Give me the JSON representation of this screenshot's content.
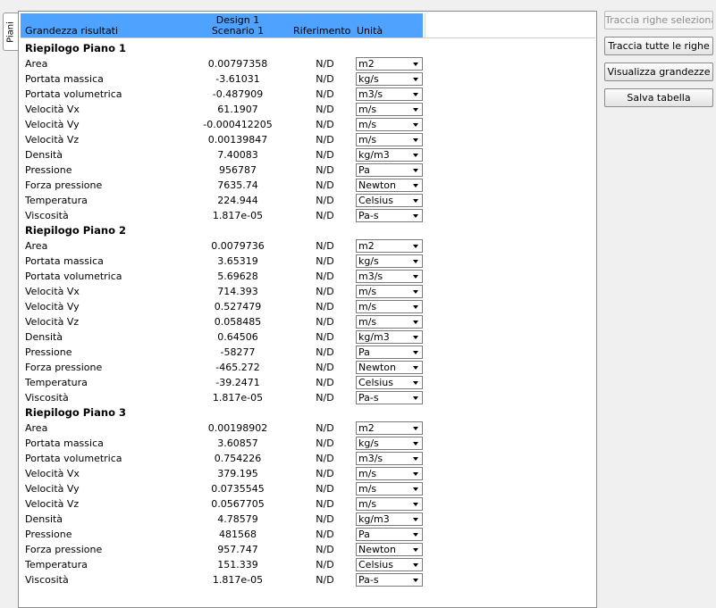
{
  "side_tab": "Piani",
  "header": {
    "col_name": "Grandezza risultati",
    "design": "Design 1",
    "scenario": "Scenario 1",
    "reference": "Riferimento",
    "unit": "Unità"
  },
  "buttons": {
    "plot_selected": "Traccia righe selezionate",
    "plot_all": "Traccia tutte le righe",
    "show_quantities": "Visualizza grandezze",
    "save_table": "Salva tabella"
  },
  "sections": [
    {
      "title": "Riepilogo Piano 1",
      "rows": [
        {
          "name": "Area",
          "value": "0.00797358",
          "ref": "N/D",
          "unit": "m2"
        },
        {
          "name": "Portata massica",
          "value": "-3.61031",
          "ref": "N/D",
          "unit": "kg/s"
        },
        {
          "name": "Portata volumetrica",
          "value": "-0.487909",
          "ref": "N/D",
          "unit": "m3/s"
        },
        {
          "name": "Velocità Vx",
          "value": "61.1907",
          "ref": "N/D",
          "unit": "m/s"
        },
        {
          "name": "Velocità Vy",
          "value": "-0.000412205",
          "ref": "N/D",
          "unit": "m/s"
        },
        {
          "name": "Velocità Vz",
          "value": "0.00139847",
          "ref": "N/D",
          "unit": "m/s"
        },
        {
          "name": "Densità",
          "value": "7.40083",
          "ref": "N/D",
          "unit": "kg/m3"
        },
        {
          "name": "Pressione",
          "value": "956787",
          "ref": "N/D",
          "unit": "Pa"
        },
        {
          "name": "Forza pressione",
          "value": "7635.74",
          "ref": "N/D",
          "unit": "Newton"
        },
        {
          "name": "Temperatura",
          "value": "224.944",
          "ref": "N/D",
          "unit": "Celsius"
        },
        {
          "name": "Viscosità",
          "value": "1.817e-05",
          "ref": "N/D",
          "unit": "Pa-s"
        }
      ]
    },
    {
      "title": "Riepilogo Piano 2",
      "rows": [
        {
          "name": "Area",
          "value": "0.0079736",
          "ref": "N/D",
          "unit": "m2"
        },
        {
          "name": "Portata massica",
          "value": "3.65319",
          "ref": "N/D",
          "unit": "kg/s"
        },
        {
          "name": "Portata volumetrica",
          "value": "5.69628",
          "ref": "N/D",
          "unit": "m3/s"
        },
        {
          "name": "Velocità Vx",
          "value": "714.393",
          "ref": "N/D",
          "unit": "m/s"
        },
        {
          "name": "Velocità Vy",
          "value": "0.527479",
          "ref": "N/D",
          "unit": "m/s"
        },
        {
          "name": "Velocità Vz",
          "value": "0.058485",
          "ref": "N/D",
          "unit": "m/s"
        },
        {
          "name": "Densità",
          "value": "0.64506",
          "ref": "N/D",
          "unit": "kg/m3"
        },
        {
          "name": "Pressione",
          "value": "-58277",
          "ref": "N/D",
          "unit": "Pa"
        },
        {
          "name": "Forza pressione",
          "value": "-465.272",
          "ref": "N/D",
          "unit": "Newton"
        },
        {
          "name": "Temperatura",
          "value": "-39.2471",
          "ref": "N/D",
          "unit": "Celsius"
        },
        {
          "name": "Viscosità",
          "value": "1.817e-05",
          "ref": "N/D",
          "unit": "Pa-s"
        }
      ]
    },
    {
      "title": "Riepilogo Piano 3",
      "rows": [
        {
          "name": "Area",
          "value": "0.00198902",
          "ref": "N/D",
          "unit": "m2"
        },
        {
          "name": "Portata massica",
          "value": "3.60857",
          "ref": "N/D",
          "unit": "kg/s"
        },
        {
          "name": "Portata volumetrica",
          "value": "0.754226",
          "ref": "N/D",
          "unit": "m3/s"
        },
        {
          "name": "Velocità Vx",
          "value": "379.195",
          "ref": "N/D",
          "unit": "m/s"
        },
        {
          "name": "Velocità Vy",
          "value": "0.0735545",
          "ref": "N/D",
          "unit": "m/s"
        },
        {
          "name": "Velocità Vz",
          "value": "0.0567705",
          "ref": "N/D",
          "unit": "m/s"
        },
        {
          "name": "Densità",
          "value": "4.78579",
          "ref": "N/D",
          "unit": "kg/m3"
        },
        {
          "name": "Pressione",
          "value": "481568",
          "ref": "N/D",
          "unit": "Pa"
        },
        {
          "name": "Forza pressione",
          "value": "957.747",
          "ref": "N/D",
          "unit": "Newton"
        },
        {
          "name": "Temperatura",
          "value": "151.339",
          "ref": "N/D",
          "unit": "Celsius"
        },
        {
          "name": "Viscosità",
          "value": "1.817e-05",
          "ref": "N/D",
          "unit": "Pa-s"
        }
      ]
    }
  ]
}
